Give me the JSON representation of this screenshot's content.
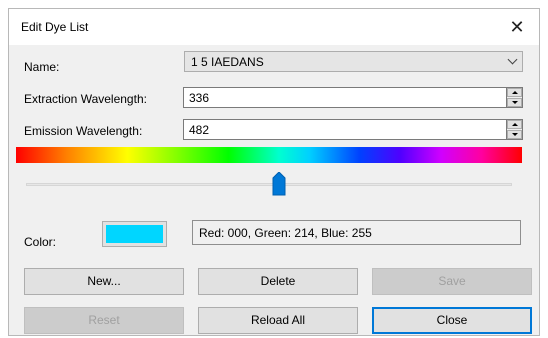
{
  "window": {
    "title": "Edit Dye List",
    "close_glyph": "✕"
  },
  "fields": {
    "name_label": "Name:",
    "name_value": "1 5 IAEDANS",
    "extraction_label": "Extraction Wavelength:",
    "extraction_value": "336",
    "emission_label": "Emission Wavelength:",
    "emission_value": "482"
  },
  "slider": {
    "value_fraction": 0.52
  },
  "color": {
    "label": "Color:",
    "swatch_hex": "#00d6ff",
    "rgb_text": "Red: 000, Green: 214, Blue: 255"
  },
  "buttons": {
    "new": "New...",
    "delete": "Delete",
    "save": "Save",
    "reset": "Reset",
    "reload_all": "Reload All",
    "close": "Close"
  },
  "icons": {
    "close": "close-icon",
    "dropdown": "chevron-down-icon",
    "spin_up": "spin-up-icon",
    "spin_down": "spin-down-icon"
  }
}
